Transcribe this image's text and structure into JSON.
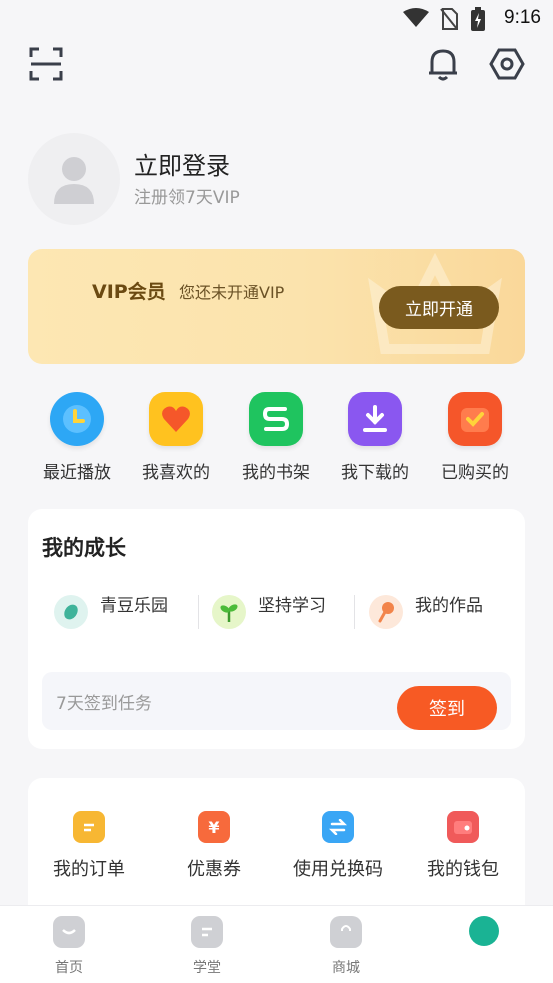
{
  "status_bar": {
    "time": "9:16"
  },
  "profile": {
    "title": "立即登录",
    "subtitle": "注册领7天VIP"
  },
  "vip": {
    "title": "VIP会员",
    "desc": "您还未开通VIP",
    "button": "立即开通"
  },
  "quick_actions": [
    {
      "label": "最近播放",
      "icon": "clock-icon",
      "color": "#2da7f5"
    },
    {
      "label": "我喜欢的",
      "icon": "heart-icon",
      "color": "#ffc21f"
    },
    {
      "label": "我的书架",
      "icon": "bookshelf-icon",
      "color": "#1fc45f"
    },
    {
      "label": "我下载的",
      "icon": "download-icon",
      "color": "#8a57f0"
    },
    {
      "label": "已购买的",
      "icon": "purchased-icon",
      "color": "#f5562a"
    }
  ],
  "growth": {
    "title": "我的成长",
    "items": [
      {
        "label": "青豆乐园",
        "icon": "bean-icon"
      },
      {
        "label": "坚持学习",
        "icon": "sprout-icon"
      },
      {
        "label": "我的作品",
        "icon": "microphone-icon"
      }
    ],
    "sign_text": "7天签到任务",
    "sign_button": "签到"
  },
  "services": [
    {
      "label": "我的订单",
      "icon": "order-icon",
      "color": "#f7b733"
    },
    {
      "label": "优惠券",
      "icon": "coupon-icon",
      "color": "#f76a3c"
    },
    {
      "label": "使用兑换码",
      "icon": "exchange-icon",
      "color": "#3aa6f5"
    },
    {
      "label": "我的钱包",
      "icon": "wallet-icon",
      "color": "#f05a5a"
    }
  ],
  "bottom_nav": [
    {
      "label": "首页",
      "icon": "home-icon"
    },
    {
      "label": "学堂",
      "icon": "school-icon"
    },
    {
      "label": "商城",
      "icon": "shop-bag-icon"
    },
    {
      "label": "",
      "icon": "me-icon"
    }
  ]
}
